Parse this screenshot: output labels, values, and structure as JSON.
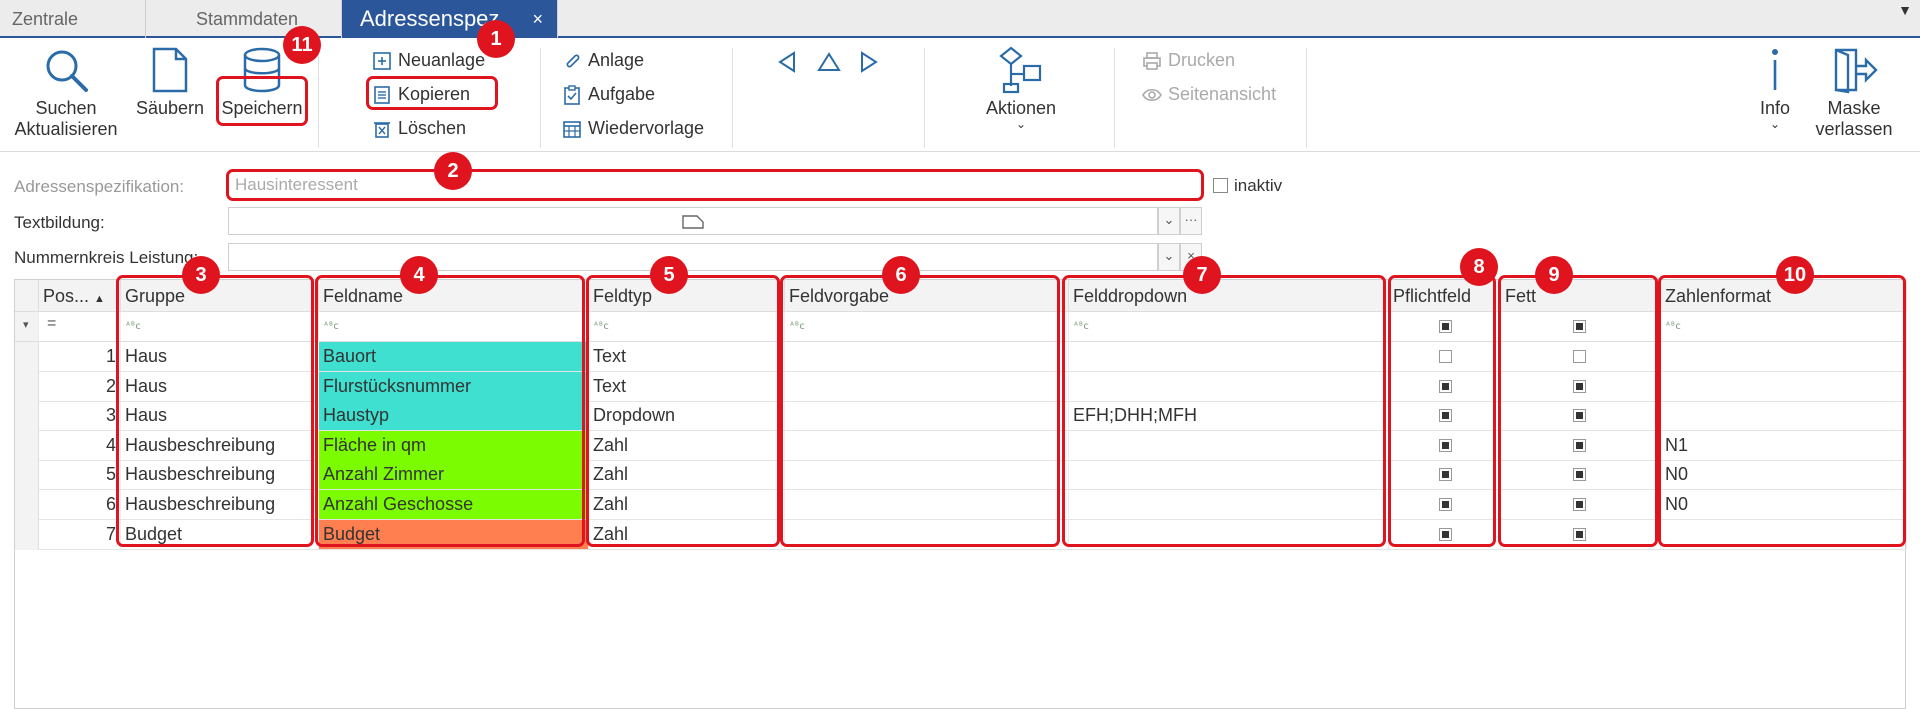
{
  "tabs": [
    {
      "label": "Zentrale"
    },
    {
      "label": "Stammdaten"
    },
    {
      "label": "Adressenspez.",
      "close": "×"
    }
  ],
  "ribbon": {
    "suchen": "Suchen",
    "aktualisieren": "Aktualisieren",
    "saeubern": "Säubern",
    "speichern": "Speichern",
    "neuanlage": "Neuanlage",
    "kopieren": "Kopieren",
    "loeschen": "Löschen",
    "anlage": "Anlage",
    "aufgabe": "Aufgabe",
    "wiedervorlage": "Wiedervorlage",
    "aktionen": "Aktionen",
    "drucken": "Drucken",
    "seitenansicht": "Seitenansicht",
    "info": "Info",
    "maske": "Maske",
    "verlassen": "verlassen"
  },
  "form": {
    "spec_label": "Adressenspezifikation:",
    "spec_value": "Hausinteressent",
    "inaktiv_label": "inaktiv",
    "textbildung_label": "Textbildung:",
    "nummernkreis_label": "Nummernkreis Leistung:"
  },
  "grid": {
    "columns": {
      "pos": "Pos...",
      "gruppe": "Gruppe",
      "feldname": "Feldname",
      "feldtyp": "Feldtyp",
      "feldvorgabe": "Feldvorgabe",
      "felddropdown": "Felddropdown",
      "pflichtfeld": "Pflichtfeld",
      "fett": "Fett",
      "zahlenformat": "Zahlenformat"
    },
    "filter_equals": "=",
    "filter_icon": "ᴬᴮc",
    "rows": [
      {
        "pos": "1",
        "gruppe": "Haus",
        "feldname": "Bauort",
        "feldtyp": "Text",
        "feldvorgabe": "",
        "felddropdown": "",
        "pflicht": false,
        "fett": false,
        "zahlenformat": "",
        "color": "#40e0d0"
      },
      {
        "pos": "2",
        "gruppe": "Haus",
        "feldname": "Flurstücksnummer",
        "feldtyp": "Text",
        "feldvorgabe": "",
        "felddropdown": "",
        "pflicht": true,
        "fett": true,
        "zahlenformat": "",
        "color": "#40e0d0"
      },
      {
        "pos": "3",
        "gruppe": "Haus",
        "feldname": "Haustyp",
        "feldtyp": "Dropdown",
        "feldvorgabe": "",
        "felddropdown": "EFH;DHH;MFH",
        "pflicht": true,
        "fett": true,
        "zahlenformat": "",
        "color": "#40e0d0"
      },
      {
        "pos": "4",
        "gruppe": "Hausbeschreibung",
        "feldname": "Fläche in qm",
        "feldtyp": "Zahl",
        "feldvorgabe": "",
        "felddropdown": "",
        "pflicht": true,
        "fett": true,
        "zahlenformat": "N1",
        "color": "#7cfc00"
      },
      {
        "pos": "5",
        "gruppe": "Hausbeschreibung",
        "feldname": "Anzahl Zimmer",
        "feldtyp": "Zahl",
        "feldvorgabe": "",
        "felddropdown": "",
        "pflicht": true,
        "fett": true,
        "zahlenformat": "N0",
        "color": "#7cfc00"
      },
      {
        "pos": "6",
        "gruppe": "Hausbeschreibung",
        "feldname": "Anzahl Geschosse",
        "feldtyp": "Zahl",
        "feldvorgabe": "",
        "felddropdown": "",
        "pflicht": true,
        "fett": true,
        "zahlenformat": "N0",
        "color": "#7cfc00"
      },
      {
        "pos": "7",
        "gruppe": "Budget",
        "feldname": "Budget",
        "feldtyp": "Zahl",
        "feldvorgabe": "",
        "felddropdown": "",
        "pflicht": true,
        "fett": true,
        "zahlenformat": "",
        "color": "#ff7f50"
      }
    ]
  },
  "callouts": [
    "1",
    "2",
    "3",
    "4",
    "5",
    "6",
    "7",
    "8",
    "9",
    "10",
    "11"
  ],
  "colors": {
    "accent": "#2b579a",
    "callout": "#e0141e"
  }
}
